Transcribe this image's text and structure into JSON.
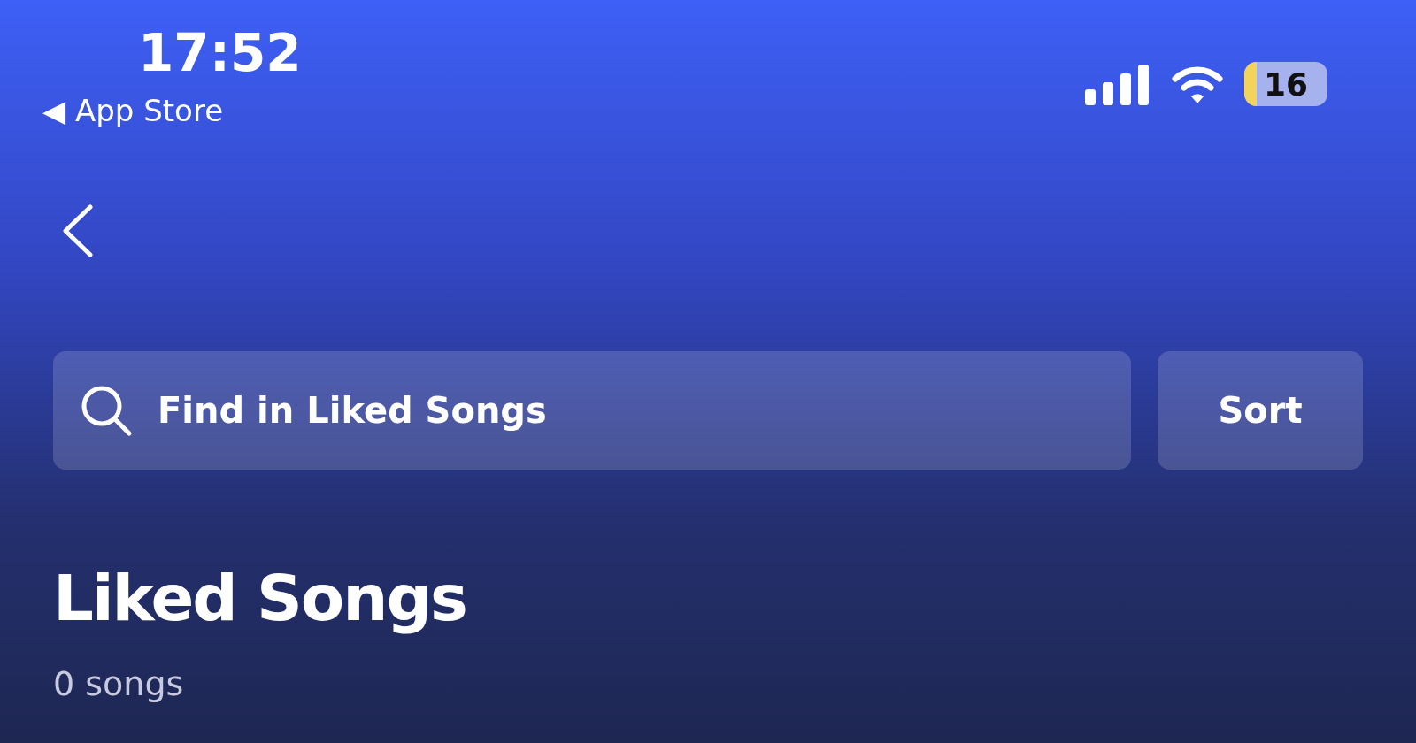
{
  "status_bar": {
    "time": "17:52",
    "back_app": "◀ App Store",
    "battery": "16"
  },
  "search": {
    "placeholder": "Find in Liked Songs"
  },
  "sort_button": "Sort",
  "title": "Liked Songs",
  "count": "0 songs"
}
